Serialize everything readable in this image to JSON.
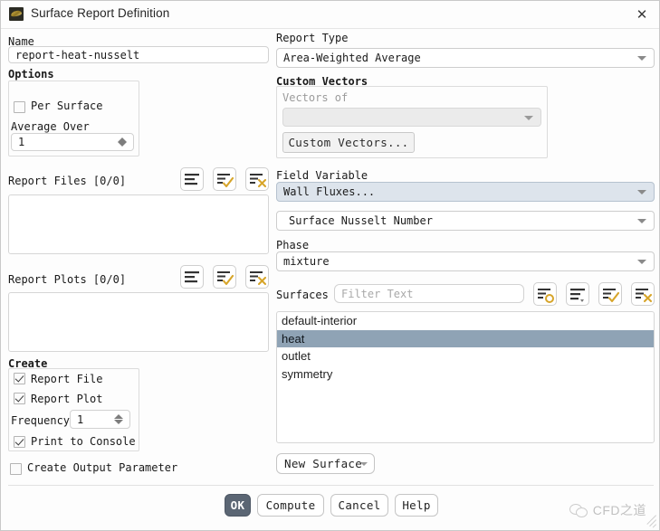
{
  "window": {
    "title": "Surface Report Definition",
    "app_icon": "fluent-app-icon",
    "close_label": "✕"
  },
  "left": {
    "name_label": "Name",
    "name_value": "report-heat-nusselt",
    "options_label": "Options",
    "per_surface_label": "Per Surface",
    "per_surface_checked": false,
    "average_over_label": "Average Over",
    "average_over_value": "1",
    "report_files_label": "Report Files [0/0]",
    "report_files_items": [],
    "report_plots_label": "Report Plots [0/0]",
    "report_plots_items": [],
    "create_label": "Create",
    "report_file_label": "Report File",
    "report_file_checked": true,
    "report_plot_label": "Report Plot",
    "report_plot_checked": true,
    "frequency_label": "Frequency",
    "frequency_value": "1",
    "print_to_console_label": "Print to Console",
    "print_to_console_checked": true,
    "create_output_parameter_label": "Create Output Parameter",
    "create_output_parameter_checked": false,
    "toolbar_icons": [
      "list-icon",
      "list-check-icon",
      "list-cross-icon"
    ]
  },
  "right": {
    "report_type_label": "Report Type",
    "report_type_value": "Area-Weighted Average",
    "custom_vectors_label": "Custom Vectors",
    "vectors_of_label": "Vectors of",
    "vectors_of_value": "",
    "custom_vectors_button": "Custom Vectors...",
    "field_variable_label": "Field Variable",
    "field_variable_value": "Wall Fluxes...",
    "field_variable_sub_value": "Surface Nusselt Number",
    "phase_label": "Phase",
    "phase_value": "mixture",
    "surfaces_label": "Surfaces",
    "surfaces_filter_placeholder": "Filter Text",
    "surfaces_filter_value": "",
    "surfaces_toolbar_icons": [
      "list-circle-icon",
      "list-dropdown-icon",
      "list-check-icon",
      "list-cross-icon"
    ],
    "surfaces": [
      {
        "label": "default-interior",
        "selected": false
      },
      {
        "label": "heat",
        "selected": true
      },
      {
        "label": "outlet",
        "selected": false
      },
      {
        "label": "symmetry",
        "selected": false
      }
    ],
    "new_surface_button": "New Surface"
  },
  "footer": {
    "ok_label": "OK",
    "compute_label": "Compute",
    "cancel_label": "Cancel",
    "help_label": "Help"
  },
  "watermark": {
    "text": "CFD之道",
    "icon": "wechat-icon"
  },
  "colors": {
    "selection_blue": "#8fa3b5",
    "combo_highlight": "#dde4ec",
    "primary_button": "#5b6674",
    "icon_gold": "#d7a52a"
  }
}
